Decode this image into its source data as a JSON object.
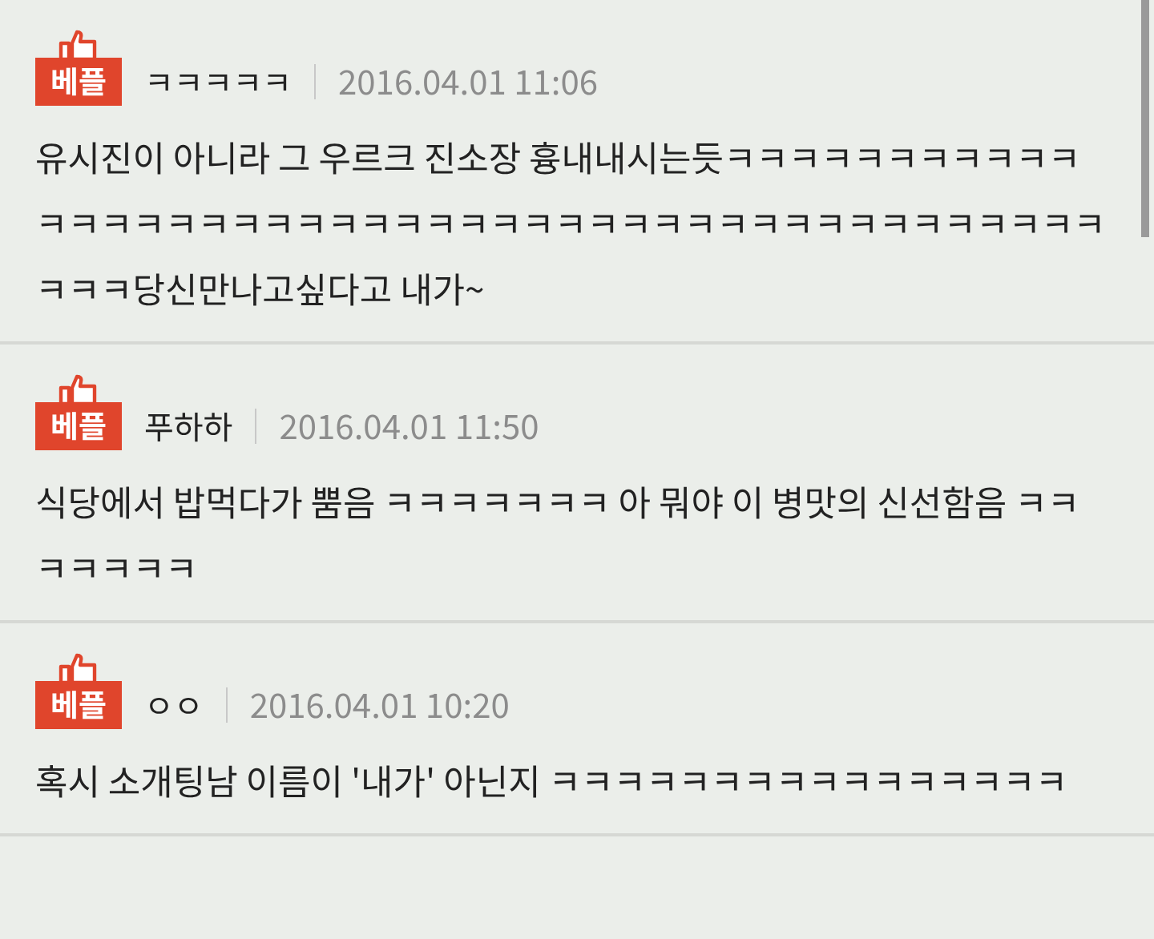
{
  "comments": [
    {
      "badge": "베플",
      "author": "ㅋㅋㅋㅋㅋ",
      "time": "2016.04.01 11:06",
      "text": "유시진이 아니라 그 우르크 진소장 흉내내시는듯ㅋㅋㅋㅋㅋㅋㅋㅋㅋㅋㅋㅋㅋㅋㅋㅋㅋㅋㅋㅋㅋㅋㅋㅋㅋㅋㅋㅋㅋㅋㅋㅋㅋㅋㅋㅋㅋㅋㅋㅋㅋㅋㅋㅋㅋㅋㅋ당신만나고싶다고 내가~"
    },
    {
      "badge": "베플",
      "author": "푸하하",
      "time": "2016.04.01 11:50",
      "text": "식당에서 밥먹다가 뿜음 ㅋㅋㅋㅋㅋㅋㅋ 아 뭐야 이 병맛의 신선함음 ㅋㅋㅋㅋㅋㅋㅋ"
    },
    {
      "badge": "베플",
      "author": "ㅇㅇ",
      "time": "2016.04.01 10:20",
      "text": "혹시 소개팅남 이름이 '내가' 아닌지 ㅋㅋㅋㅋㅋㅋㅋㅋㅋㅋㅋㅋㅋㅋㅋㅋ"
    }
  ]
}
